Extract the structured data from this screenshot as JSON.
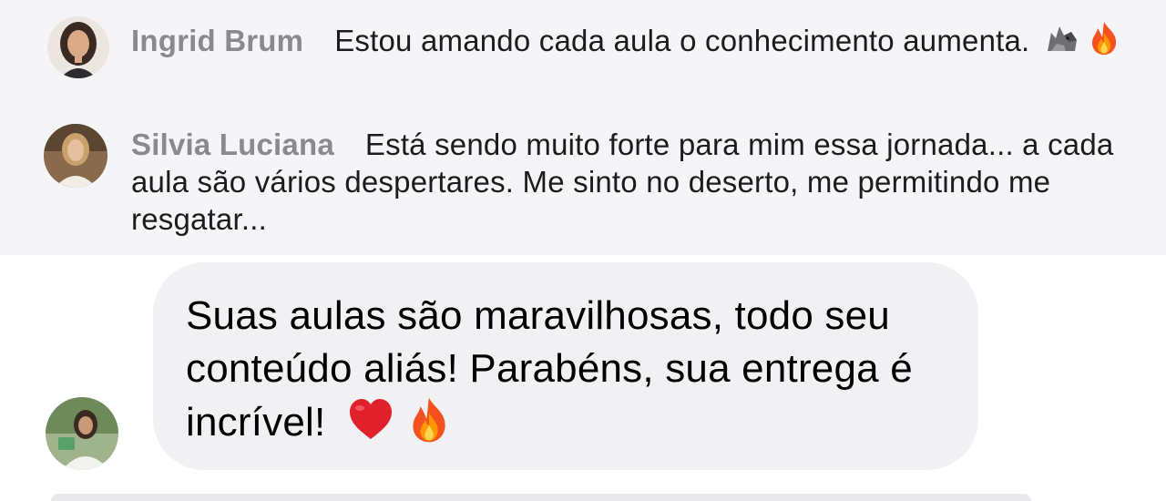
{
  "comments": [
    {
      "author": "Ingrid Brum",
      "text": "Estou amando cada aula o conhecimento aumenta.",
      "emojis": [
        "wolf-emoji",
        "fire-emoji"
      ],
      "avatar": "avatar-ingrid-brum"
    },
    {
      "author": "Silvia Luciana",
      "text": "Está sendo muito forte para mim essa jornada... a cada aula são vários despertares. Me sinto no deserto, me permitindo me resgatar...",
      "emojis": [],
      "avatar": "avatar-silvia-luciana"
    }
  ],
  "message": {
    "text": "Suas aulas são maravilhosas, todo seu conteúdo aliás! Parabéns, sua entrega é incrível!",
    "emojis": [
      "red-heart-emoji",
      "fire-emoji"
    ],
    "avatar": "avatar-sender"
  },
  "colors": {
    "panel_background": "#f5f5f7",
    "bubble_background": "#f1f1f3",
    "author_text": "#8a8a8e",
    "body_text": "#1c1c1e",
    "heart": "#e0202b",
    "fire": "#f7931e"
  }
}
